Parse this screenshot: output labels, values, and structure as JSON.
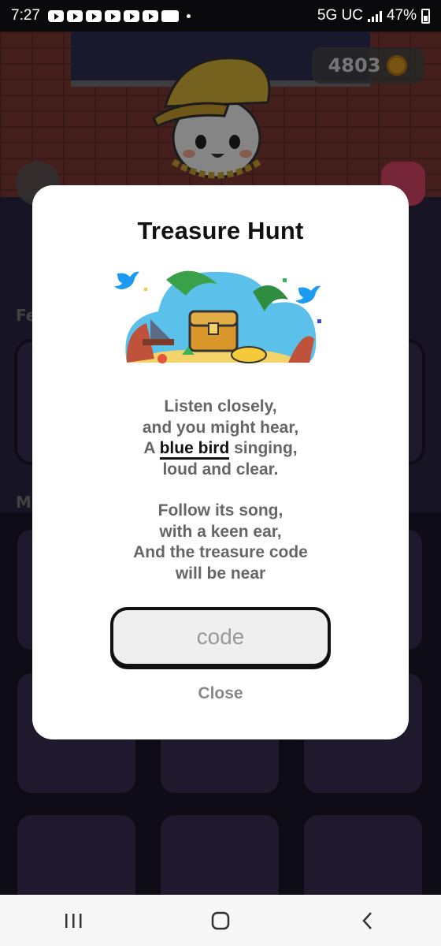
{
  "status_bar": {
    "time": "7:27",
    "network": "5G UC",
    "battery": "47%"
  },
  "game": {
    "coins": "4803",
    "section_featured_label": "Fe",
    "section_more_label": "M"
  },
  "dialog": {
    "title": "Treasure Hunt",
    "poem": {
      "line1": "Listen closely,",
      "line2": "and you might hear,",
      "line3_prefix": "A ",
      "line3_highlight": "blue bird",
      "line3_suffix": " singing,",
      "line4": "loud and clear.",
      "line5": "Follow its song,",
      "line6": "with a keen ear,",
      "line7": "And the treasure code",
      "line8": "will be near"
    },
    "code_placeholder": "code",
    "close_label": "Close"
  },
  "icons": {
    "bird": "twitter-bird-icon",
    "coin": "coin-icon",
    "camera": "camera-icon",
    "block": "block-icon"
  },
  "colors": {
    "dialog_bg": "#ffffff",
    "bird_blue": "#1d9bf0",
    "close_text": "#888888",
    "poem_text": "#666666"
  }
}
